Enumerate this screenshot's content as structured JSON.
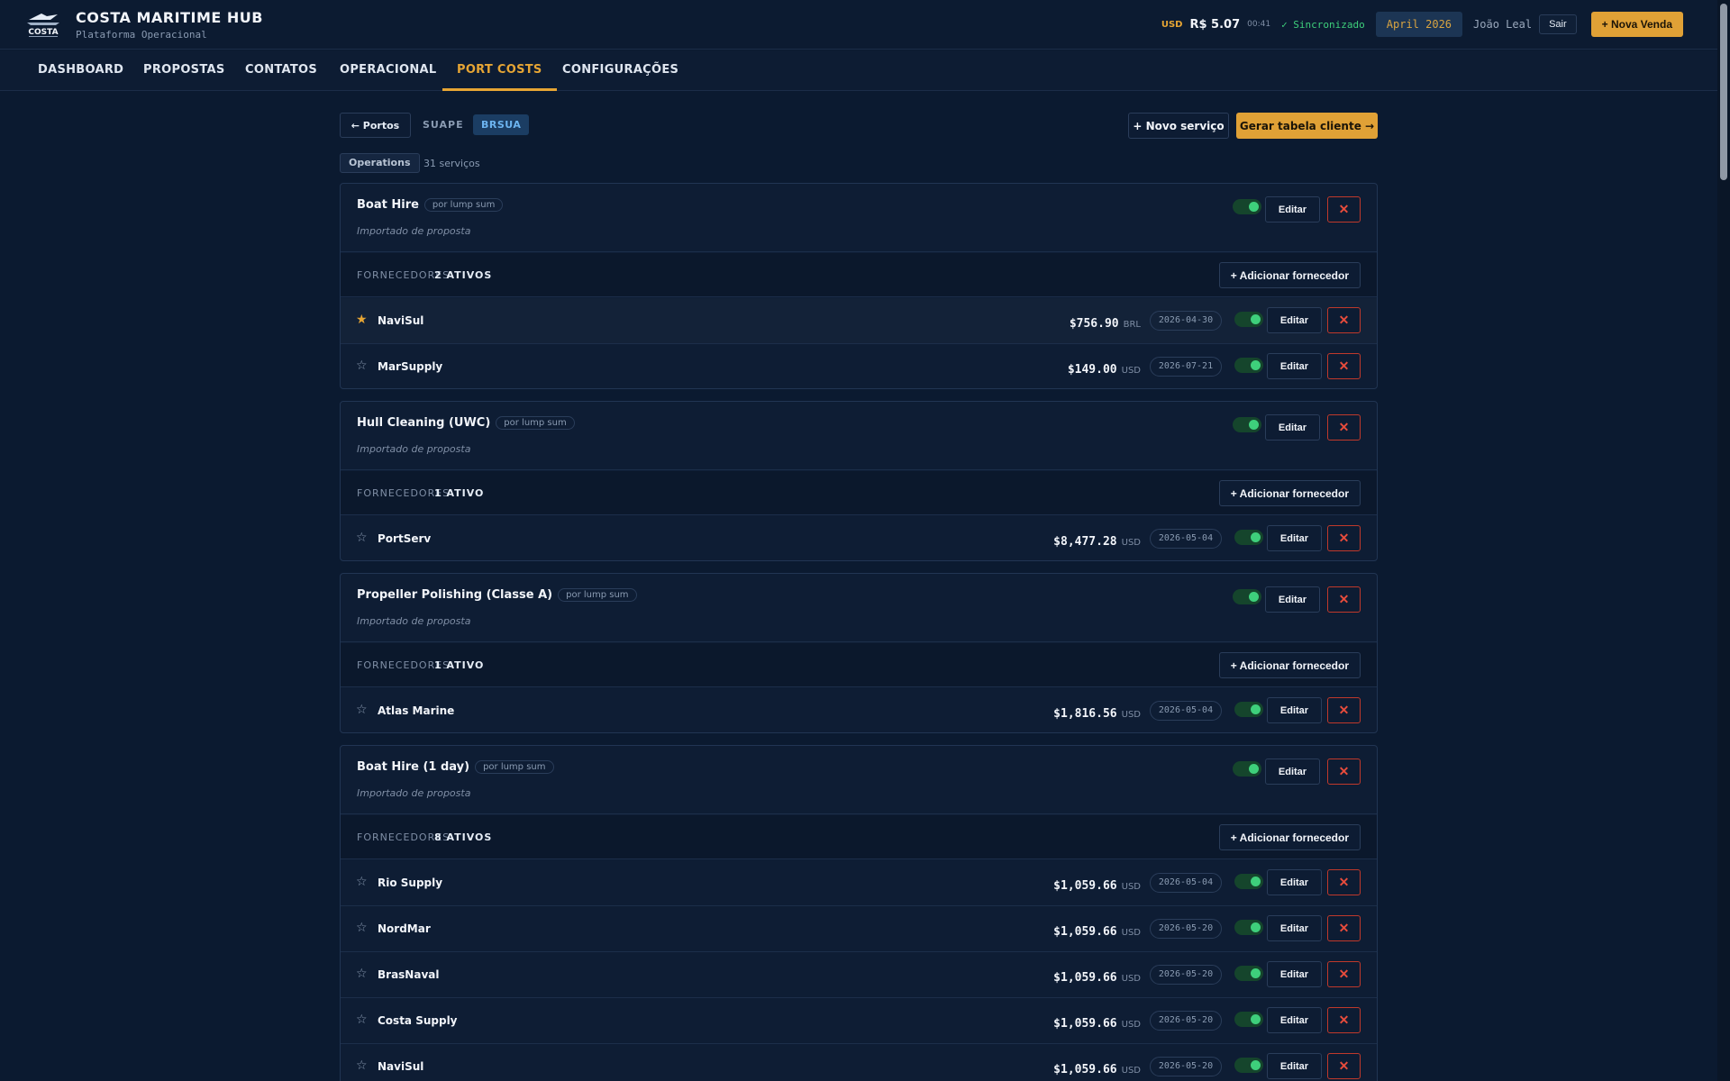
{
  "app": {
    "title": "COSTA MARITIME HUB",
    "subtitle": "Plataforma Operacional",
    "logo_text": "COSTA"
  },
  "header": {
    "rate_currency": "USD",
    "rate_value": "R$ 5.07",
    "rate_time": "00:41",
    "sync_status": "✓ Sincronizado",
    "month": "April 2026",
    "user": "João Leal",
    "logout_label": "Sair",
    "new_sale_label": "+ Nova Venda"
  },
  "nav": {
    "items": [
      "DASHBOARD",
      "PROPOSTAS",
      "CONTATOS",
      "OPERACIONAL",
      "PORT COSTS",
      "CONFIGURAÇÕES"
    ],
    "active": "PORT COSTS"
  },
  "toolbar": {
    "back_label": "← Portos",
    "port_name": "SUAPE",
    "port_code": "BRSUA",
    "new_service_label": "+ Novo serviço",
    "generate_table_label": "Gerar tabela cliente →",
    "category": "Operations",
    "service_count": "31 serviços"
  },
  "labels": {
    "suppliers": "FORNECEDORES",
    "add_supplier": "+ Adicionar fornecedor",
    "edit": "Editar",
    "delete_icon": "✕",
    "star_on": "★",
    "star_off": "☆"
  },
  "services": [
    {
      "name": "Boat Hire",
      "unit": "por lump sum",
      "note": "Importado de proposta",
      "active_count": "2 ATIVOS",
      "suppliers": [
        {
          "name": "NaviSul",
          "price": "$756.90",
          "currency": "BRL",
          "date": "2026-04-30",
          "favorite": true
        },
        {
          "name": "MarSupply",
          "price": "$149.00",
          "currency": "USD",
          "date": "2026-07-21",
          "favorite": false
        }
      ]
    },
    {
      "name": "Hull Cleaning (UWC)",
      "unit": "por lump sum",
      "note": "Importado de proposta",
      "active_count": "1 ATIVO",
      "suppliers": [
        {
          "name": "PortServ",
          "price": "$8,477.28",
          "currency": "USD",
          "date": "2026-05-04",
          "favorite": false
        }
      ]
    },
    {
      "name": "Propeller Polishing (Classe A)",
      "unit": "por lump sum",
      "note": "Importado de proposta",
      "active_count": "1 ATIVO",
      "suppliers": [
        {
          "name": "Atlas Marine",
          "price": "$1,816.56",
          "currency": "USD",
          "date": "2026-05-04",
          "favorite": false
        }
      ]
    },
    {
      "name": "Boat Hire (1 day)",
      "unit": "por lump sum",
      "note": "Importado de proposta",
      "active_count": "8 ATIVOS",
      "suppliers": [
        {
          "name": "Rio Supply",
          "price": "$1,059.66",
          "currency": "USD",
          "date": "2026-05-04",
          "favorite": false
        },
        {
          "name": "NordMar",
          "price": "$1,059.66",
          "currency": "USD",
          "date": "2026-05-20",
          "favorite": false
        },
        {
          "name": "BrasNaval",
          "price": "$1,059.66",
          "currency": "USD",
          "date": "2026-05-20",
          "favorite": false
        },
        {
          "name": "Costa Supply",
          "price": "$1,059.66",
          "currency": "USD",
          "date": "2026-05-20",
          "favorite": false
        },
        {
          "name": "NaviSul",
          "price": "$1,059.66",
          "currency": "USD",
          "date": "2026-05-20",
          "favorite": false
        }
      ]
    }
  ],
  "colors": {
    "accent": "#e0a136",
    "background": "#0b1a30",
    "active_toggle": "#3ecf7b",
    "danger": "#e74c3c",
    "port_code": "#6cb4f0"
  }
}
